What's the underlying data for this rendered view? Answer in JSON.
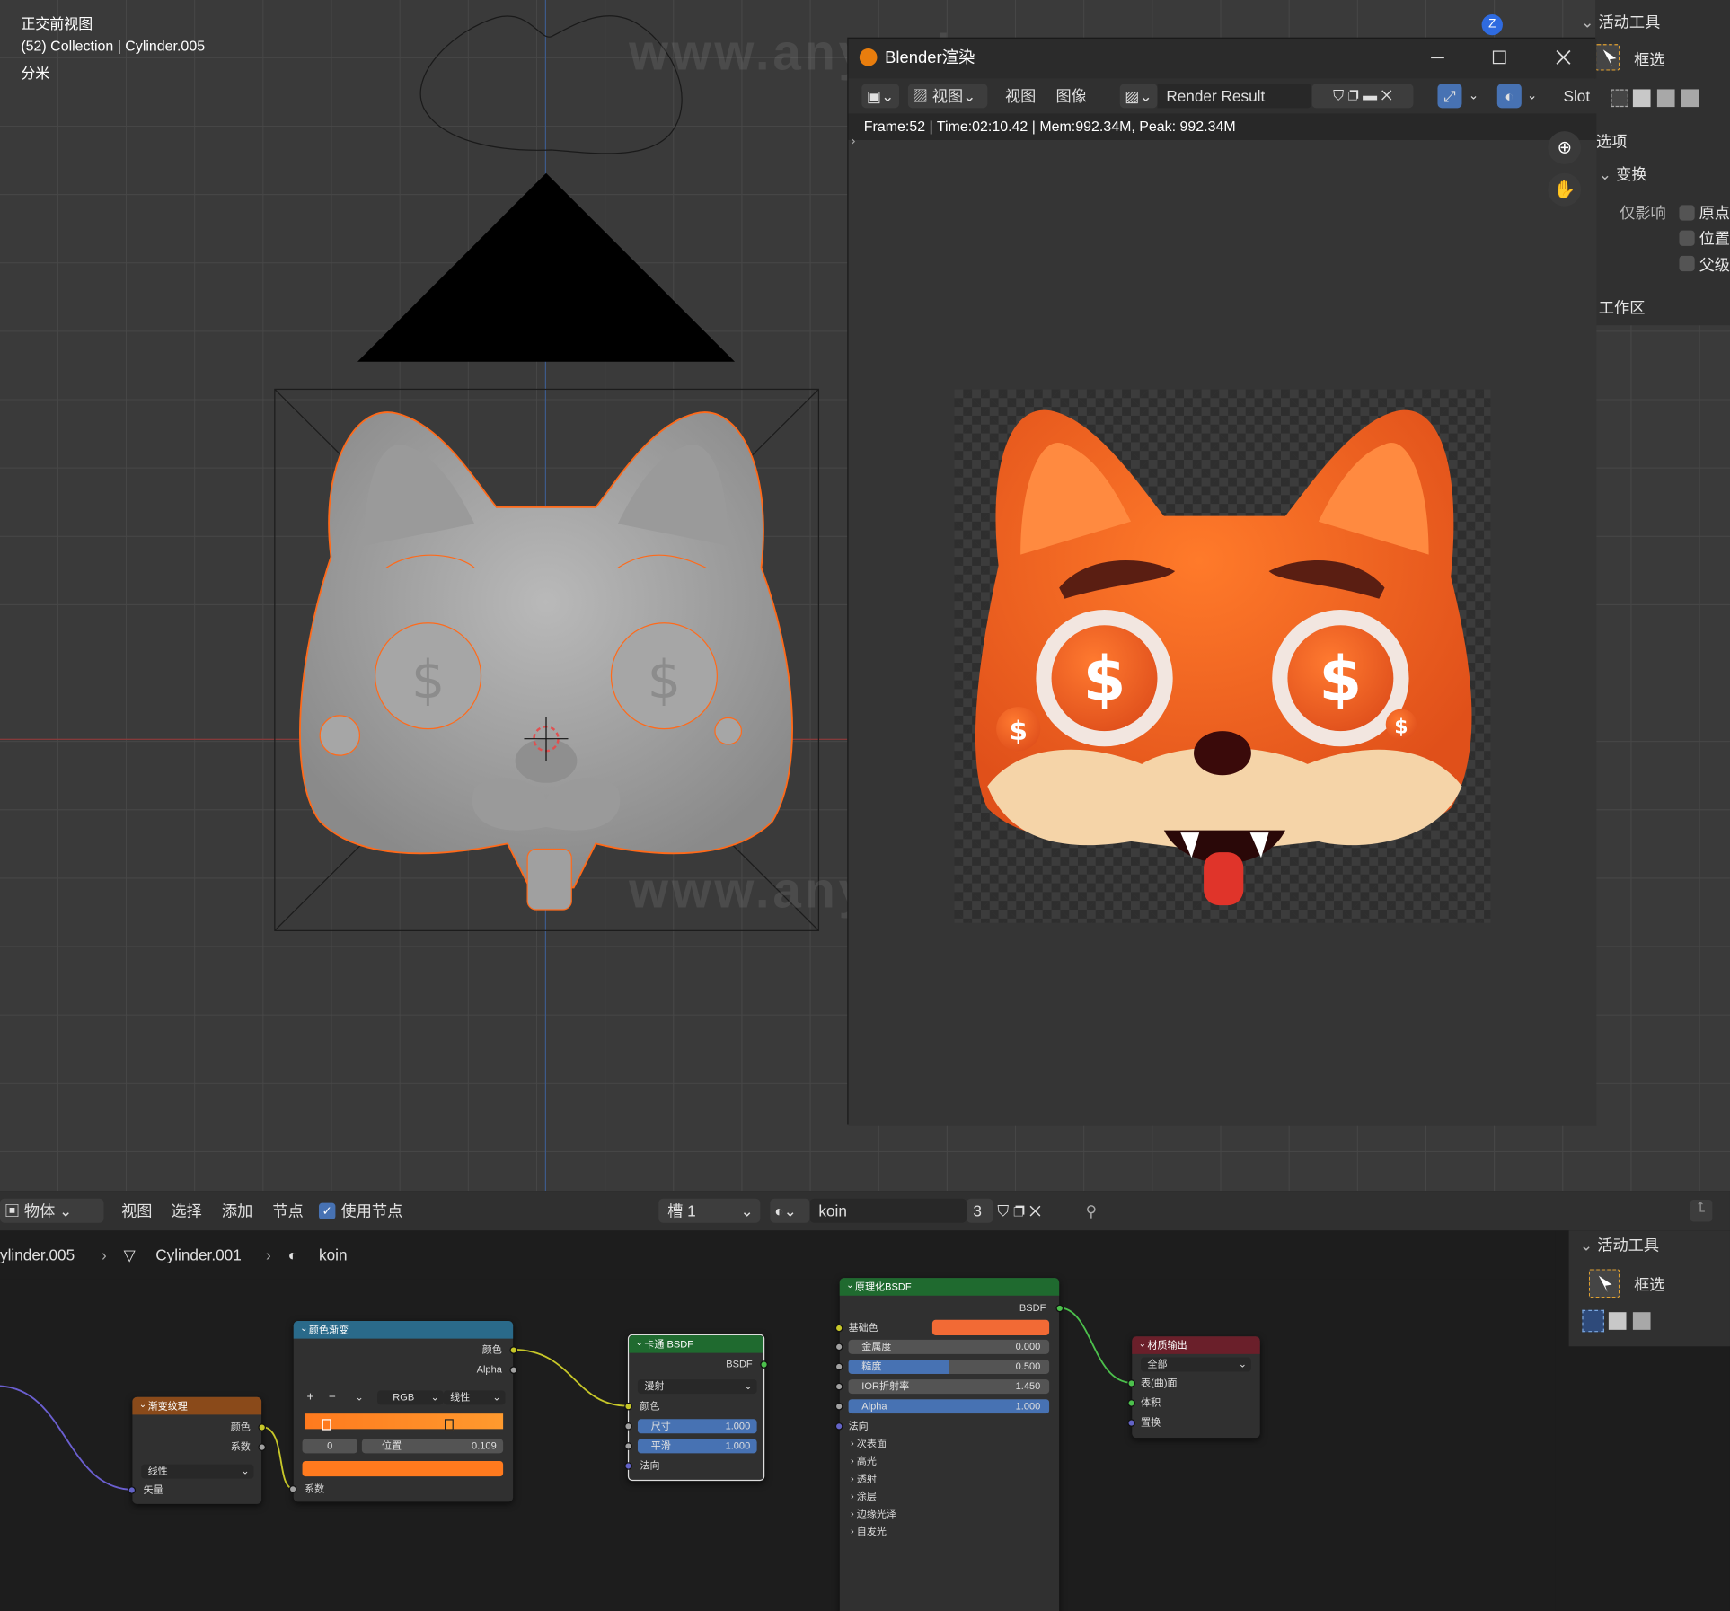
{
  "viewport": {
    "view_name": "正交前视图",
    "collection_info": "(52) Collection | Cylinder.005",
    "unit": "分米",
    "axis_gizmo": "Z",
    "watermark": "www.anyusj.com"
  },
  "n_panel": {
    "active_tool_header": "活动工具",
    "select_box_label": "框选",
    "options_header": "选项",
    "transform_header": "变换",
    "affect_only_label": "仅影响",
    "origin_label": "原点",
    "location_label": "位置",
    "parent_label": "父级",
    "workspace_label": "工作区"
  },
  "render_window": {
    "title": "Blender渲染",
    "toolbar": {
      "view_menu": "视图",
      "view_label": "视图",
      "image_label": "图像",
      "image_name": "Render Result",
      "slot_label": "Slot"
    },
    "info_line": "Frame:52 | Time:02:10.42 | Mem:992.34M, Peak: 992.34M"
  },
  "node_editor": {
    "header": {
      "object_mode": "物体",
      "menu_view": "视图",
      "menu_select": "选择",
      "menu_add": "添加",
      "menu_node": "节点",
      "use_nodes": "使用节点",
      "slot": "槽 1",
      "material_name": "koin",
      "user_count": "3"
    },
    "breadcrumb": {
      "object": "ylinder.005",
      "mesh": "Cylinder.001",
      "material": "koin"
    },
    "sidebar": {
      "active_tool_header": "活动工具",
      "select_box_label": "框选"
    },
    "nodes": {
      "gradient_texture": {
        "title": "渐变纹理",
        "out_color": "颜色",
        "out_factor": "系数",
        "type": "线性",
        "in_vector": "矢量"
      },
      "color_ramp": {
        "title": "颜色渐变",
        "out_color": "颜色",
        "out_alpha": "Alpha",
        "plus": "+",
        "minus": "−",
        "mode": "RGB",
        "interp": "线性",
        "stop_index": "0",
        "pos_label": "位置",
        "pos_value": "0.109",
        "in_factor": "系数",
        "color_left": "#ff7a1e",
        "color_right": "#ff9a2e"
      },
      "toon_bsdf": {
        "title": "卡通 BSDF",
        "out_bsdf": "BSDF",
        "component": "漫射",
        "in_color": "颜色",
        "size_label": "尺寸",
        "size_value": "1.000",
        "smooth_label": "平滑",
        "smooth_value": "1.000",
        "in_normal": "法向"
      },
      "principled_bsdf": {
        "title": "原理化BSDF",
        "out_bsdf": "BSDF",
        "base_color": "基础色",
        "base_color_hex": "#f26a35",
        "metallic_label": "金属度",
        "metallic_value": "0.000",
        "roughness_label": "糙度",
        "roughness_value": "0.500",
        "roughness": 0.5,
        "ior_label": "IOR折射率",
        "ior_value": "1.450",
        "alpha_label": "Alpha",
        "alpha_value": "1.000",
        "alpha": 1.0,
        "normal": "法向",
        "subsurface": "次表面",
        "specular": "高光",
        "transmission": "透射",
        "coat": "涂层",
        "sheen": "边缘光泽",
        "emission": "自发光"
      },
      "material_output": {
        "title": "材质输出",
        "target": "全部",
        "in_surface": "表(曲)面",
        "in_volume": "体积",
        "in_displacement": "置换"
      }
    }
  }
}
